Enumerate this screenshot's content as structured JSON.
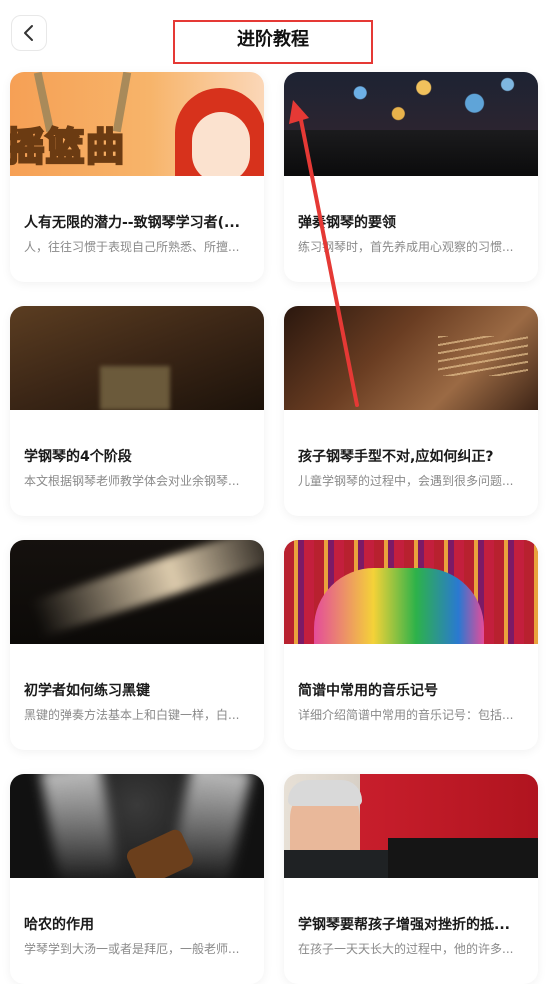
{
  "header": {
    "title": "进阶教程",
    "back_icon": "chevron-left-icon"
  },
  "annotation_color": "#e53935",
  "cards": [
    {
      "title": "人有无限的潜力--致钢琴学习者(...",
      "desc": "人，往往习惯于表现自己所熟悉、所擅...",
      "thumb_text": "摇篮曲"
    },
    {
      "title": "弹奏钢琴的要领",
      "desc": "练习钢琴时，首先养成用心观察的习惯..."
    },
    {
      "title": "学钢琴的4个阶段",
      "desc": "本文根据钢琴老师教学体会对业余钢琴..."
    },
    {
      "title": "孩子钢琴手型不对,应如何纠正?",
      "desc": "儿童学钢琴的过程中，会遇到很多问题..."
    },
    {
      "title": "初学者如何练习黑键",
      "desc": "黑键的弹奏方法基本上和白键一样，白..."
    },
    {
      "title": "简谱中常用的音乐记号",
      "desc": "详细介绍简谱中常用的音乐记号：包括..."
    },
    {
      "title": "哈农的作用",
      "desc": "学琴学到大汤一或者是拜厄，一般老师..."
    },
    {
      "title": "学钢琴要帮孩子增强对挫折的抵...",
      "desc": "在孩子一天天长大的过程中，他的许多..."
    }
  ]
}
